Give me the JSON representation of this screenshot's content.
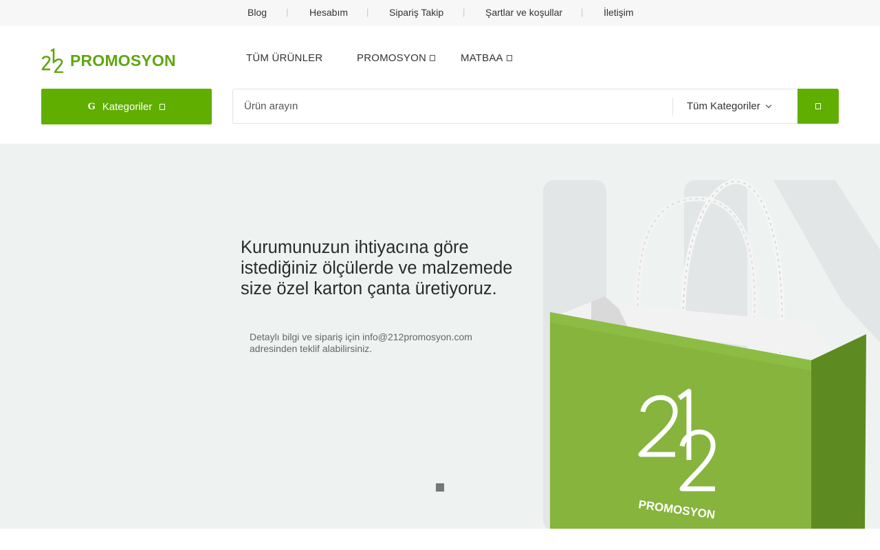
{
  "topbar": {
    "links": [
      "Blog",
      "Hesabım",
      "Sipariş Takip",
      "Şartlar ve koşullar",
      "İletişim"
    ],
    "separator": "|"
  },
  "header": {
    "logo_number": "212",
    "logo_text": "PROMOSYON",
    "nav": [
      "TÜM ÜRÜNLER",
      "PROMOSYON",
      "MATBAA"
    ]
  },
  "categories_button": {
    "icon_text": "G",
    "label": "Kategoriler"
  },
  "search": {
    "placeholder": "Ürün arayın",
    "category_selected": "Tüm Kategoriler"
  },
  "hero": {
    "title": "Kurumunuzun ihtiyacına göre istediğiniz ölçülerde ve malzemede size özel karton çanta üretiyoruz.",
    "subtitle": "Detaylı bilgi ve sipariş için info@212promosyon.com adresinden teklif alabilirsiniz.",
    "bag_brand_number": "212",
    "bag_brand_text": "PROMOSYON"
  },
  "colors": {
    "brand_green": "#5fae00",
    "logo_green": "#5ea70f",
    "bag_green": "#86b43d",
    "hero_bg": "#eef3f2"
  },
  "icons": {
    "category": "g-icon",
    "nav_caret": "square-caret-icon",
    "search": "search-icon",
    "dropdown": "chevron-down-icon"
  }
}
